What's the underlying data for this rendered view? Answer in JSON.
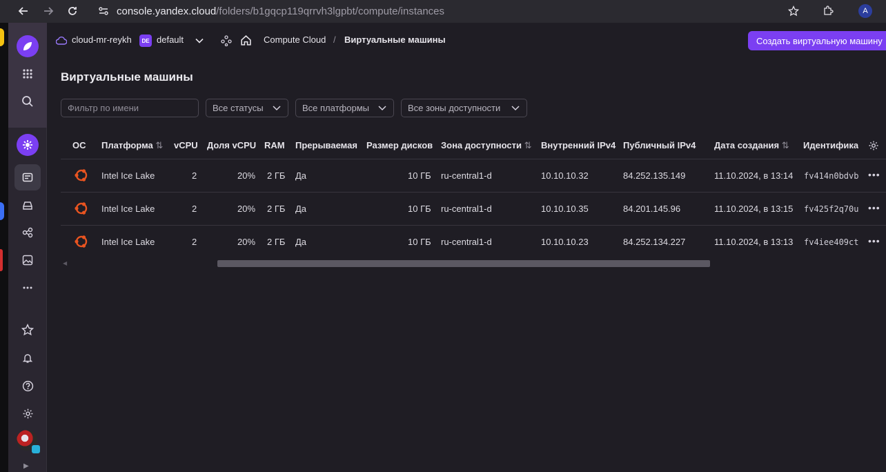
{
  "browser": {
    "url_host": "console.yandex.cloud",
    "url_path": "/folders/b1gqcp119qrrvh3lgpbt/compute/instances",
    "profile_initial": "A"
  },
  "header": {
    "cloud_name": "cloud-mr-reykh",
    "folder_badge": "DE",
    "folder_name": "default",
    "service": "Compute Cloud",
    "separator": "/",
    "current_page": "Виртуальные машины",
    "create_button": "Создать виртуальную машину"
  },
  "page": {
    "title": "Виртуальные машины"
  },
  "filters": {
    "name_placeholder": "Фильтр по имени",
    "status": "Все статусы",
    "platform": "Все платформы",
    "zone": "Все зоны доступности"
  },
  "table": {
    "columns": {
      "os": "ОС",
      "platform": "Платформа",
      "vcpu": "vCPU",
      "vcpu_share": "Доля vCPU",
      "ram": "RAM",
      "preemptible": "Прерываемая",
      "disk_size": "Размер дисков",
      "zone": "Зона доступности",
      "ipv4_internal": "Внутренний IPv4",
      "ipv4_public": "Публичный IPv4",
      "created": "Дата создания",
      "id": "Идентифика"
    },
    "rows": [
      {
        "os": "ubuntu",
        "platform": "Intel Ice Lake",
        "vcpu": "2",
        "vcpu_share": "20%",
        "ram": "2 ГБ",
        "preemptible": "Да",
        "disk_size": "10 ГБ",
        "zone": "ru-central1-d",
        "ipv4_internal": "10.10.10.32",
        "ipv4_public": "84.252.135.149",
        "created": "11.10.2024, в 13:14",
        "id": "fv414n0bdvb"
      },
      {
        "os": "ubuntu",
        "platform": "Intel Ice Lake",
        "vcpu": "2",
        "vcpu_share": "20%",
        "ram": "2 ГБ",
        "preemptible": "Да",
        "disk_size": "10 ГБ",
        "zone": "ru-central1-d",
        "ipv4_internal": "10.10.10.35",
        "ipv4_public": "84.201.145.96",
        "created": "11.10.2024, в 13:15",
        "id": "fv425f2q70u"
      },
      {
        "os": "ubuntu",
        "platform": "Intel Ice Lake",
        "vcpu": "2",
        "vcpu_share": "20%",
        "ram": "2 ГБ",
        "preemptible": "Да",
        "disk_size": "10 ГБ",
        "zone": "ru-central1-d",
        "ipv4_internal": "10.10.10.23",
        "ipv4_public": "84.252.134.227",
        "created": "11.10.2024, в 13:13",
        "id": "fv4iee409ct"
      }
    ]
  },
  "colors": {
    "accent": "#7b3ff2",
    "ubuntu": "#e95420",
    "background": "#1f1d24"
  }
}
